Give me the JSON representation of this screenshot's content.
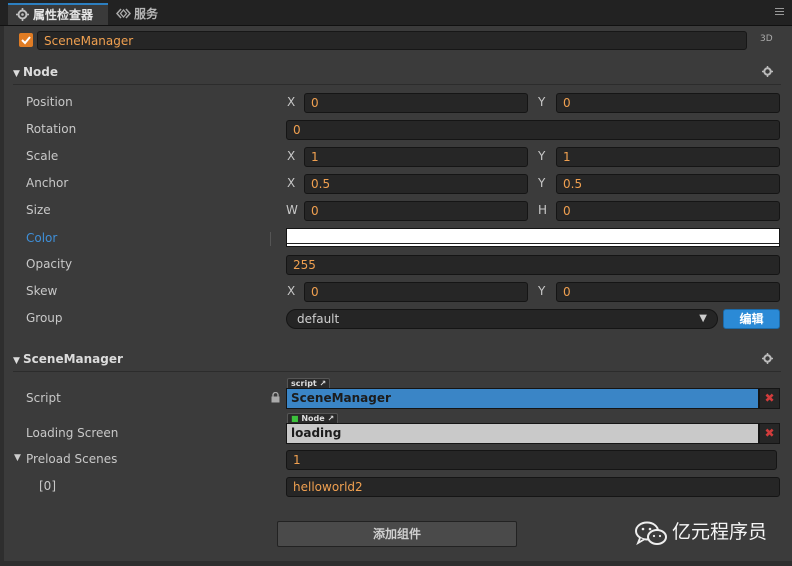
{
  "tabs": [
    {
      "label": "属性检查器",
      "icon": "gear-icon"
    },
    {
      "label": "服务",
      "icon": "services-icon"
    }
  ],
  "node_header": {
    "checked": true,
    "name": "SceneManager",
    "mode_label": "3D"
  },
  "node_section": {
    "title": "Node",
    "position": {
      "label": "Position",
      "x_axis": "X",
      "x": "0",
      "y_axis": "Y",
      "y": "0"
    },
    "rotation": {
      "label": "Rotation",
      "value": "0"
    },
    "scale": {
      "label": "Scale",
      "x_axis": "X",
      "x": "1",
      "y_axis": "Y",
      "y": "1"
    },
    "anchor": {
      "label": "Anchor",
      "x_axis": "X",
      "x": "0.5",
      "y_axis": "Y",
      "y": "0.5"
    },
    "size": {
      "label": "Size",
      "w_axis": "W",
      "w": "0",
      "h_axis": "H",
      "h": "0"
    },
    "color": {
      "label": "Color",
      "value": "#ffffff"
    },
    "opacity": {
      "label": "Opacity",
      "value": "255"
    },
    "skew": {
      "label": "Skew",
      "x_axis": "X",
      "x": "0",
      "y_axis": "Y",
      "y": "0"
    },
    "group": {
      "label": "Group",
      "value": "default",
      "edit_label": "编辑"
    }
  },
  "component_section": {
    "title": "SceneManager",
    "script": {
      "label": "Script",
      "badge": "script",
      "value": "SceneManager"
    },
    "loading_screen": {
      "label": "Loading Screen",
      "badge": "Node",
      "value": "loading"
    },
    "preload_scenes": {
      "label": "Preload Scenes",
      "count": "1",
      "items": [
        {
          "index": "[0]",
          "value": "helloworld2"
        }
      ]
    }
  },
  "add_component_label": "添加组件",
  "watermark": "亿元程序员",
  "colors": {
    "accent": "#2b8ad6",
    "value_orange": "#f0a050",
    "script_blue": "#3a85c6",
    "remove_red": "#d23c3c"
  }
}
